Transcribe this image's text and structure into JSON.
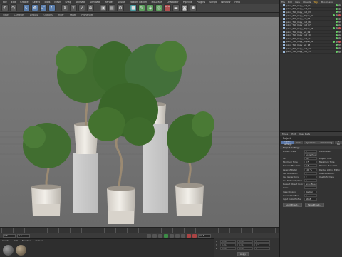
{
  "window": {
    "title": ""
  },
  "menubar": [
    "File",
    "Edit",
    "Create",
    "Select",
    "Tools",
    "Mesh",
    "Snap",
    "Animate",
    "Simulate",
    "Render",
    "Sculpt",
    "Motion Tracker",
    "MoGraph",
    "Character",
    "Pipeline",
    "Plugins",
    "Script",
    "Window",
    "Help"
  ],
  "viewport": {
    "menu": [
      "View",
      "Cameras",
      "Display",
      "Options",
      "Filter",
      "Panel",
      "ProRender"
    ],
    "label": "Perspective",
    "grid_spacing": "Grid Spacing : 100 cm"
  },
  "timeline": {
    "start_frame": "0 F",
    "end_frame": "90 F",
    "current": "0 F"
  },
  "materials": {
    "menu": [
      "Create",
      "Edit",
      "Function",
      "Texture"
    ],
    "swatches": [
      "#6a6a6a",
      "#8a7a64"
    ]
  },
  "coords": {
    "rows": [
      {
        "axis": "X",
        "val": "0 cm",
        "val2": "0 cm",
        "val3": "0 °"
      },
      {
        "axis": "Y",
        "val": "0 cm",
        "val2": "0 cm",
        "val3": "0 °"
      },
      {
        "axis": "Z",
        "val": "0 cm",
        "val2": "0 cm",
        "val3": "0 °"
      }
    ],
    "apply_label": "Apply"
  },
  "object_manager": {
    "menu": [
      "File",
      "Edit",
      "View",
      "Objects",
      "Tags",
      "Bookmarks"
    ],
    "active_menu": "Tags",
    "objects": [
      {
        "name": "plant_T10_Copy_Inst_01"
      },
      {
        "name": "plant_T10_Copy_Inst_02"
      },
      {
        "name": "plant_T10_Copy_Inst_03"
      },
      {
        "name": "plant_T10_Copy_Ellipse_04"
      },
      {
        "name": "plant_T10_Copy_pot_05"
      },
      {
        "name": "plant_T10_Copy_Inst_06"
      },
      {
        "name": "plant_T10_Copy_Inst_07"
      },
      {
        "name": "plant_T10_Copy_Ellipse_08"
      },
      {
        "name": "plant_T10_Copy_pot_09"
      },
      {
        "name": "plant_T10_Copy_Inst_10"
      },
      {
        "name": "plant_T10_Copy_Inst_11"
      },
      {
        "name": "plant_T10_Copy_Ellipse_12"
      },
      {
        "name": "plant_T10_Copy_pot_13"
      },
      {
        "name": "plant_T10_Copy_Inst_14"
      },
      {
        "name": "plant_T10_Copy_Inst_15"
      }
    ]
  },
  "attribute_manager": {
    "menu": [
      "Mode",
      "Edit",
      "User Data"
    ],
    "title": "Project",
    "tabs": [
      "Project Settings",
      "Info",
      "Dynamics",
      "Referencing",
      "To Do"
    ],
    "active_tab": "Project Settings",
    "section": "Project Settings",
    "rows": [
      {
        "label": "Project Scale",
        "value": "1",
        "label2": "Centimeters"
      },
      {
        "label": "",
        "value": "Scale Project...",
        "label2": ""
      },
      {
        "label": "FPS",
        "value": "30",
        "label2": "Project Time"
      },
      {
        "label": "Minimum Time",
        "value": "0 F",
        "label2": "Maximum Time"
      },
      {
        "label": "Preview Min Time",
        "value": "0 F",
        "label2": "Preview Max Time"
      },
      {
        "label": "Level of Detail",
        "value": "100 %",
        "label2": "Render LOD in Editor"
      },
      {
        "label": "Use Animation",
        "value": "✓",
        "label2": "Use Expression"
      },
      {
        "label": "Use Generators",
        "value": "✓",
        "label2": "Use Deformers"
      },
      {
        "label": "Use Motion System",
        "value": "✓",
        "label2": ""
      },
      {
        "label": "Default Object Color",
        "value": "Gray-Blue",
        "label2": ""
      },
      {
        "label": "Color",
        "value": "",
        "label2": ""
      },
      {
        "label": "View Clipping",
        "value": "Medium",
        "label2": ""
      },
      {
        "label": "Linear Workflow",
        "value": "✓",
        "label2": ""
      },
      {
        "label": "Input Color Profile",
        "value": "sRGB",
        "label2": ""
      }
    ],
    "buttons": [
      "Load Preset...",
      "Save Preset..."
    ]
  }
}
